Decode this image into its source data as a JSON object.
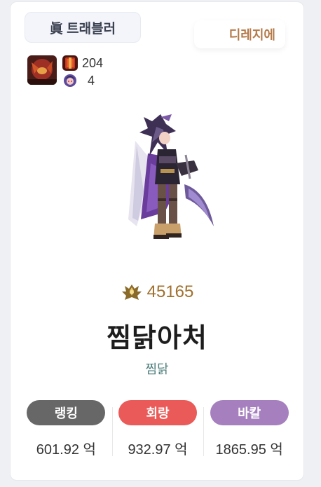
{
  "header": {
    "job_title": "眞 트래블러",
    "server": "디레지에"
  },
  "character": {
    "stat_1": "204",
    "stat_2": "4",
    "fame": "45165",
    "name": "찜닭아처",
    "guild": "찜닭"
  },
  "stats": [
    {
      "label": "랭킹",
      "value": "601.92 억",
      "color": "#676767"
    },
    {
      "label": "회랑",
      "value": "932.97 억",
      "color": "#e95a58"
    },
    {
      "label": "바칼",
      "value": "1865.95 억",
      "color": "#a57fbe"
    }
  ]
}
